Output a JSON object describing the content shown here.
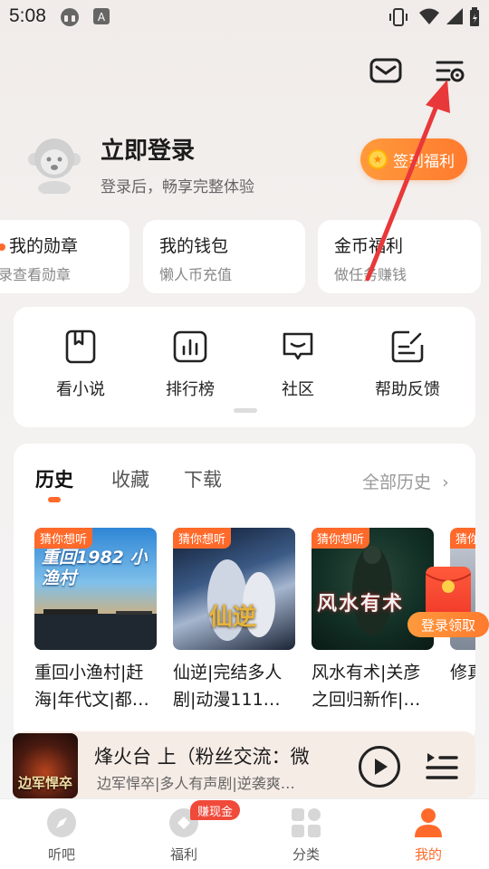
{
  "status_bar": {
    "time": "5:08"
  },
  "header": {
    "message_icon": "mail-icon",
    "settings_icon": "settings-list-icon"
  },
  "profile": {
    "title": "立即登录",
    "subtitle": "登录后，畅享完整体验",
    "signin_label": "签到福利"
  },
  "quick_cards": [
    {
      "title": "我的勋章",
      "subtitle": "录查看勋章"
    },
    {
      "title": "我的钱包",
      "subtitle": "懒人币充值"
    },
    {
      "title": "金币福利",
      "subtitle": "做任务赚钱"
    }
  ],
  "functions": [
    {
      "label": "看小说",
      "icon": "book-icon"
    },
    {
      "label": "排行榜",
      "icon": "ranking-icon"
    },
    {
      "label": "社区",
      "icon": "community-icon"
    },
    {
      "label": "帮助反馈",
      "icon": "feedback-icon"
    }
  ],
  "history": {
    "tabs": [
      "历史",
      "收藏",
      "下载"
    ],
    "active_tab": 0,
    "all_label": "全部历史",
    "badge": "猜你想听",
    "books": [
      {
        "title_line1": "重回小渔村|赶",
        "title_line2": "海|年代文|都…",
        "cover_text": "重回1982 小渔村"
      },
      {
        "title_line1": "仙逆|完结多人",
        "title_line2": "剧|动漫111…",
        "cover_text": "仙逆"
      },
      {
        "title_line1": "风水有术|关彦",
        "title_line2": "之回归新作|…",
        "cover_text": "风水有术"
      },
      {
        "title_line1": "修真",
        "title_line2": "",
        "cover_text": ""
      }
    ]
  },
  "floating": {
    "envelope_label": "登录领取"
  },
  "player": {
    "title": "烽火台 上（粉丝交流：微",
    "subtitle": "边军悍卒|多人有声剧|逆袭爽…",
    "cover_text": "边军悍卒"
  },
  "bottom_nav": {
    "items": [
      {
        "label": "听吧",
        "icon": "compass-icon"
      },
      {
        "label": "福利",
        "icon": "coin-icon"
      },
      {
        "label": "分类",
        "icon": "grid-icon"
      },
      {
        "label": "我的",
        "icon": "person-icon"
      }
    ],
    "active": 3,
    "earn_badge": "赚现金"
  },
  "colors": {
    "accent": "#ff6a2a",
    "annotation": "#e8383a"
  }
}
